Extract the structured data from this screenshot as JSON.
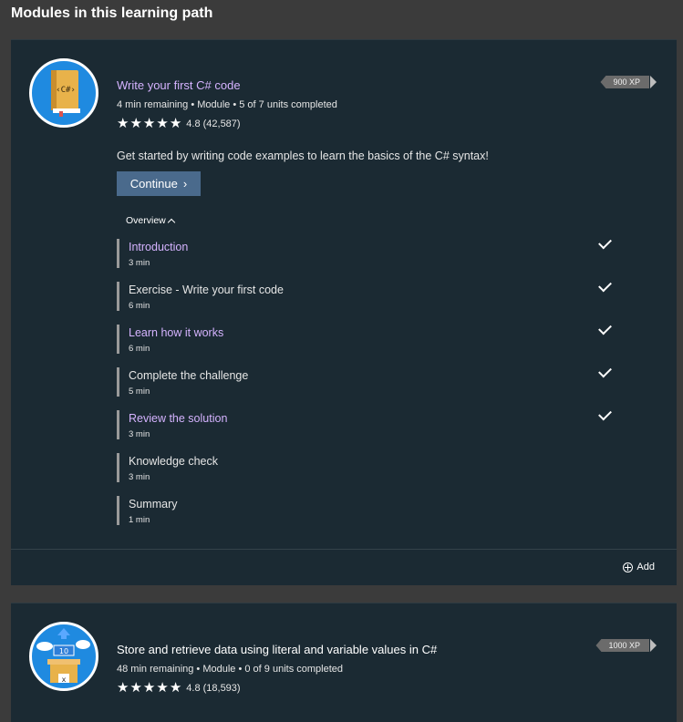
{
  "section_title": "Modules in this learning path",
  "modules": [
    {
      "title": "Write your first C# code",
      "meta": "4 min remaining • Module • 5 of 7 units completed",
      "rating": "4.8 (42,587)",
      "xp": "900 XP",
      "icon": "csharp-book-icon",
      "icon_text": "‹C#›",
      "description": "Get started by writing code examples to learn the basics of the C# syntax!",
      "continue_label": "Continue",
      "overview_label": "Overview",
      "add_label": "Add",
      "units": [
        {
          "name": "Introduction",
          "duration": "3 min",
          "completed": true,
          "visited": true
        },
        {
          "name": "Exercise - Write your first code",
          "duration": "6 min",
          "completed": true,
          "visited": false
        },
        {
          "name": "Learn how it works",
          "duration": "6 min",
          "completed": true,
          "visited": true
        },
        {
          "name": "Complete the challenge",
          "duration": "5 min",
          "completed": true,
          "visited": false
        },
        {
          "name": "Review the solution",
          "duration": "3 min",
          "completed": true,
          "visited": true
        },
        {
          "name": "Knowledge check",
          "duration": "3 min",
          "completed": false,
          "visited": false
        },
        {
          "name": "Summary",
          "duration": "1 min",
          "completed": false,
          "visited": false
        }
      ]
    },
    {
      "title": "Store and retrieve data using literal and variable values in C#",
      "meta": "48 min remaining • Module • 0 of 9 units completed",
      "rating": "4.8 (18,593)",
      "xp": "1000 XP",
      "icon": "data-box-icon",
      "icon_text_top": "10",
      "icon_text_bottom": "x"
    }
  ],
  "colors": {
    "background": "#3b3b3b",
    "card": "#1b2a33",
    "accent_visited": "#d5b3ff",
    "button": "#4a6a8c",
    "icon_blue": "#1f8ae0"
  }
}
